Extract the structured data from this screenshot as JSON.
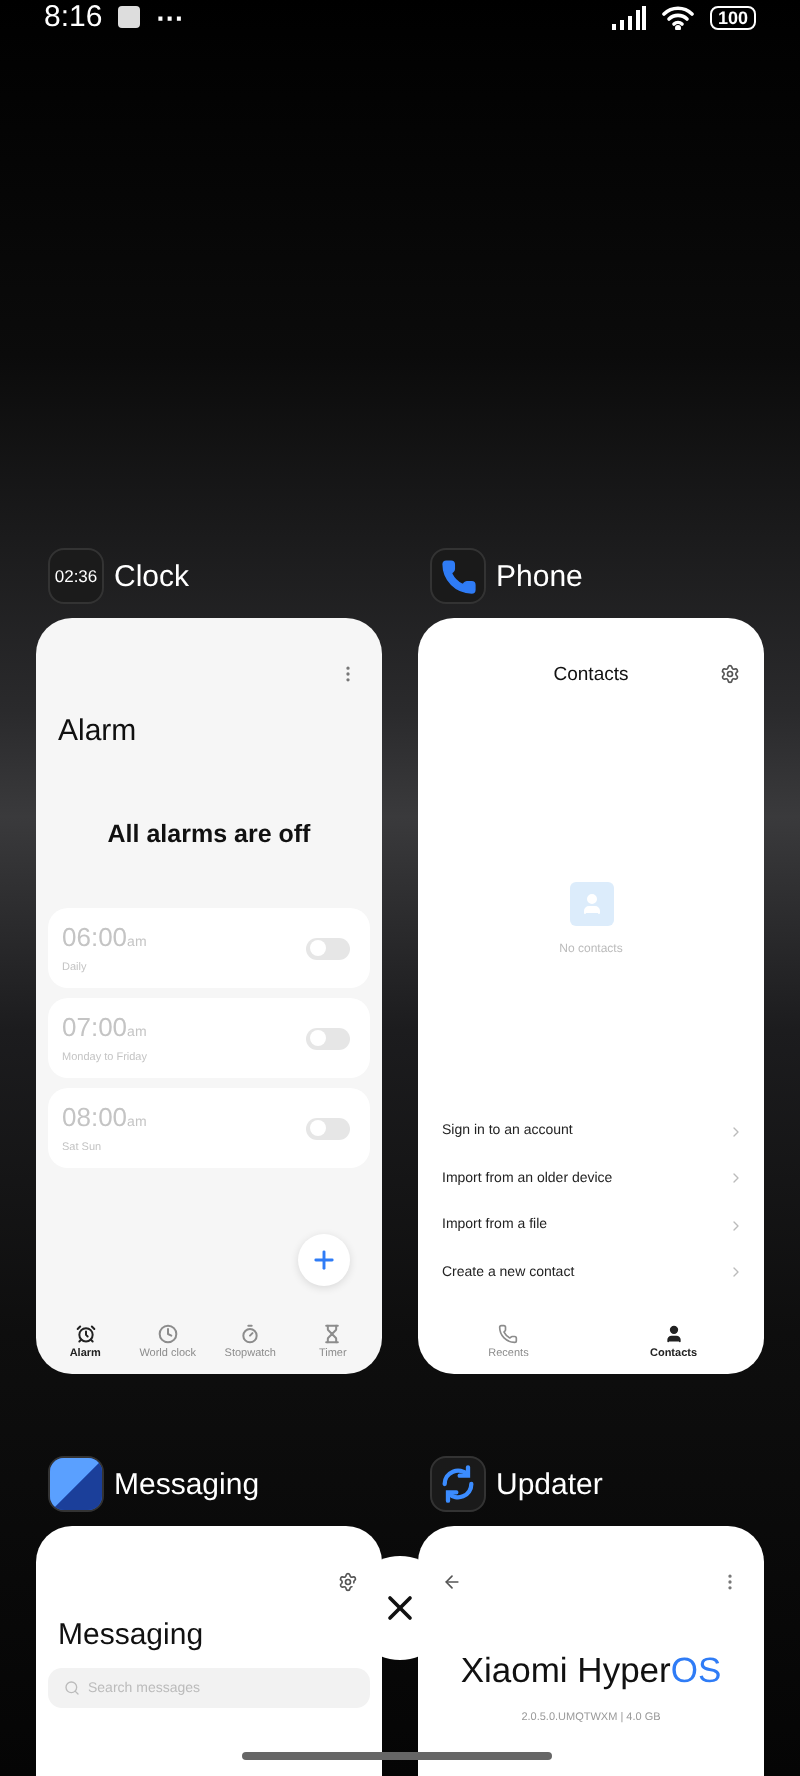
{
  "status_bar": {
    "time": "8:16",
    "overflow": "···",
    "battery": "100"
  },
  "apps": [
    {
      "kind": "clock",
      "name": "Clock",
      "icon_text": "02:36",
      "title": "Alarm",
      "empty_message": "All alarms are off",
      "alarms": [
        {
          "time": "06:00",
          "period": "am",
          "repeat": "Daily",
          "on": false
        },
        {
          "time": "07:00",
          "period": "am",
          "repeat": "Monday to Friday",
          "on": false
        },
        {
          "time": "08:00",
          "period": "am",
          "repeat": "Sat Sun",
          "on": false
        }
      ],
      "tabs": [
        {
          "label": "Alarm",
          "selected": true
        },
        {
          "label": "World clock",
          "selected": false
        },
        {
          "label": "Stopwatch",
          "selected": false
        },
        {
          "label": "Timer",
          "selected": false
        }
      ]
    },
    {
      "kind": "phone",
      "name": "Phone",
      "title": "Contacts",
      "empty_message": "No contacts",
      "actions": [
        "Sign in to an account",
        "Import from an older device",
        "Import from a file",
        "Create a new contact"
      ],
      "tabs": [
        {
          "label": "Recents",
          "selected": false
        },
        {
          "label": "Contacts",
          "selected": true
        }
      ]
    },
    {
      "kind": "messaging",
      "name": "Messaging",
      "title": "Messaging",
      "search": {
        "placeholder": "Search messages"
      }
    },
    {
      "kind": "updater",
      "name": "Updater",
      "title": "Xiaomi Hyper",
      "title_accent": "OS",
      "version": "2.0.5.0.UMQTWXM | 4.0 GB"
    }
  ]
}
